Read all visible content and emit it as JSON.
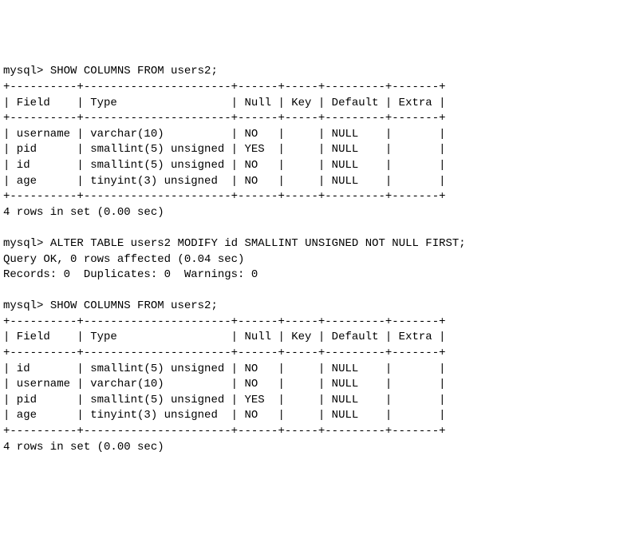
{
  "prompt": "mysql>",
  "cmd1": "SHOW COLUMNS FROM users2;",
  "cmd2": "ALTER TABLE users2 MODIFY id SMALLINT UNSIGNED NOT NULL FIRST;",
  "cmd3": "SHOW COLUMNS FROM users2;",
  "border": "+----------+----------------------+------+-----+---------+-------+",
  "header": "| Field    | Type                 | Null | Key | Default | Extra |",
  "table1": {
    "rows": [
      "| username | varchar(10)          | NO   |     | NULL    |       |",
      "| pid      | smallint(5) unsigned | YES  |     | NULL    |       |",
      "| id       | smallint(5) unsigned | NO   |     | NULL    |       |",
      "| age      | tinyint(3) unsigned  | NO   |     | NULL    |       |"
    ]
  },
  "rows_in_set": "4 rows in set (0.00 sec)",
  "query_ok": "Query OK, 0 rows affected (0.04 sec)",
  "records_line": "Records: 0  Duplicates: 0  Warnings: 0",
  "table2": {
    "rows": [
      "| id       | smallint(5) unsigned | NO   |     | NULL    |       |",
      "| username | varchar(10)          | NO   |     | NULL    |       |",
      "| pid      | smallint(5) unsigned | YES  |     | NULL    |       |",
      "| age      | tinyint(3) unsigned  | NO   |     | NULL    |       |"
    ]
  },
  "chart_data": {
    "type": "table",
    "tables": [
      {
        "title": "SHOW COLUMNS FROM users2 (before)",
        "columns": [
          "Field",
          "Type",
          "Null",
          "Key",
          "Default",
          "Extra"
        ],
        "rows": [
          [
            "username",
            "varchar(10)",
            "NO",
            "",
            "NULL",
            ""
          ],
          [
            "pid",
            "smallint(5) unsigned",
            "YES",
            "",
            "NULL",
            ""
          ],
          [
            "id",
            "smallint(5) unsigned",
            "NO",
            "",
            "NULL",
            ""
          ],
          [
            "age",
            "tinyint(3) unsigned",
            "NO",
            "",
            "NULL",
            ""
          ]
        ]
      },
      {
        "title": "SHOW COLUMNS FROM users2 (after)",
        "columns": [
          "Field",
          "Type",
          "Null",
          "Key",
          "Default",
          "Extra"
        ],
        "rows": [
          [
            "id",
            "smallint(5) unsigned",
            "NO",
            "",
            "NULL",
            ""
          ],
          [
            "username",
            "varchar(10)",
            "NO",
            "",
            "NULL",
            ""
          ],
          [
            "pid",
            "smallint(5) unsigned",
            "YES",
            "",
            "NULL",
            ""
          ],
          [
            "age",
            "tinyint(3) unsigned",
            "NO",
            "",
            "NULL",
            ""
          ]
        ]
      }
    ]
  }
}
